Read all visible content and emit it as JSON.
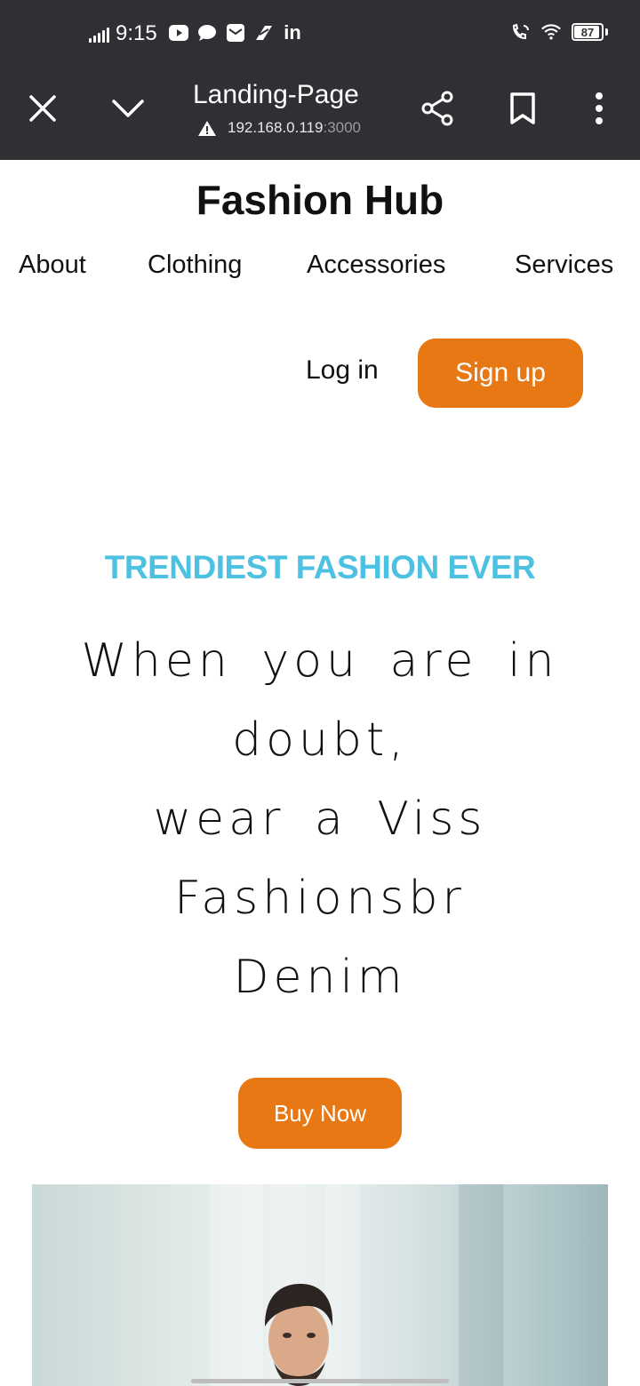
{
  "status_bar": {
    "time": "9:15",
    "battery": "87",
    "left_icons": [
      "youtube-icon",
      "chat-icon",
      "mail-icon",
      "app-icon",
      "linkedin-icon"
    ],
    "linkedin_text": "in",
    "right_icons": [
      "wifi-call-icon",
      "wifi-icon",
      "battery-icon"
    ]
  },
  "browser": {
    "title": "Landing-Page",
    "url_host": "192.168.0.119",
    "url_port": ":3000",
    "toolbar_bg": "#2f3033"
  },
  "page": {
    "brand": "Fashion Hub",
    "nav": [
      "About",
      "Clothing",
      "Accessories",
      "Services"
    ],
    "login_label": "Log in",
    "signup_label": "Sign up",
    "tagline": "TRENDIEST FASHION EVER",
    "hero_lines": [
      "When you are in",
      "doubt,",
      "wear a Viss",
      "Fashionsbr",
      "Denim"
    ],
    "buy_label": "Buy Now"
  },
  "colors": {
    "accent_orange": "#e77814",
    "tagline_blue": "#4cc1e2"
  }
}
